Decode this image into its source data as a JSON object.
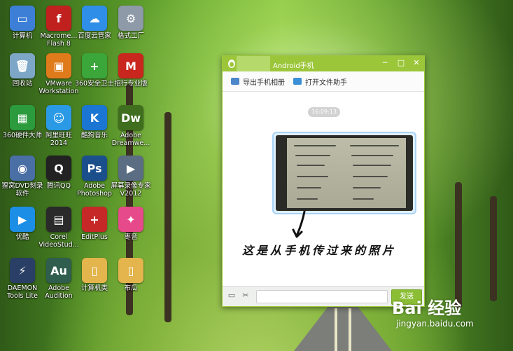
{
  "desktop": {
    "icons": [
      {
        "label": "计算机",
        "icon": "computer-icon",
        "color": "#3d7fd6",
        "glyph": "▭"
      },
      {
        "label": "Macrome... Flash 8",
        "icon": "flash-icon",
        "color": "#c0201e",
        "glyph": "f"
      },
      {
        "label": "百度云管家",
        "icon": "baidu-cloud-icon",
        "color": "#2f8ee8",
        "glyph": "☁"
      },
      {
        "label": "格式工厂",
        "icon": "format-factory-icon",
        "color": "#8e9aa8",
        "glyph": "⚙"
      },
      {
        "label": "回收站",
        "icon": "recycle-bin-icon",
        "color": "#7ea7c7",
        "glyph": "🗑"
      },
      {
        "label": "VMware Workstation",
        "icon": "vmware-icon",
        "color": "#e07b1c",
        "glyph": "▣"
      },
      {
        "label": "360安全卫士",
        "icon": "360-safe-icon",
        "color": "#3ba63a",
        "glyph": "+"
      },
      {
        "label": "招行专业版",
        "icon": "cmb-icon",
        "color": "#c9261d",
        "glyph": "M"
      },
      {
        "label": "360硬件大师",
        "icon": "360-hardware-icon",
        "color": "#2c9b3e",
        "glyph": "▦"
      },
      {
        "label": "阿里旺旺 2014",
        "icon": "aliwangwang-icon",
        "color": "#2b9ae6",
        "glyph": "☺"
      },
      {
        "label": "酷狗音乐",
        "icon": "kugou-icon",
        "color": "#1b76d3",
        "glyph": "K"
      },
      {
        "label": "Adobe Dreamwe...",
        "icon": "dreamweaver-icon",
        "color": "#3f6e1e",
        "glyph": "Dw"
      },
      {
        "label": "狸窝DVD刻录软件",
        "icon": "dvd-burner-icon",
        "color": "#4a6fa5",
        "glyph": "◉"
      },
      {
        "label": "腾讯QQ",
        "icon": "qq-icon",
        "color": "#222222",
        "glyph": "Q"
      },
      {
        "label": "Adobe Photoshop",
        "icon": "photoshop-icon",
        "color": "#1b4f8c",
        "glyph": "Ps"
      },
      {
        "label": "屏幕录像专家V2012",
        "icon": "screen-recorder-icon",
        "color": "#5b6d82",
        "glyph": "▶"
      },
      {
        "label": "优酷",
        "icon": "youku-icon",
        "color": "#1c8ee6",
        "glyph": "▶"
      },
      {
        "label": "Corel VideoStud...",
        "icon": "corel-video-icon",
        "color": "#2a2a2a",
        "glyph": "▤"
      },
      {
        "label": "EditPlus",
        "icon": "editplus-icon",
        "color": "#c62828",
        "glyph": "+"
      },
      {
        "label": "枣音",
        "icon": "zaoyin-icon",
        "color": "#e64a8a",
        "glyph": "✦"
      },
      {
        "label": "DAEMON Tools Lite",
        "icon": "daemon-tools-icon",
        "color": "#2a3f66",
        "glyph": "⚡"
      },
      {
        "label": "Adobe Audition",
        "icon": "audition-icon",
        "color": "#2f5e4f",
        "glyph": "Au"
      },
      {
        "label": "计算机类",
        "icon": "folder-icon",
        "color": "#e3b54c",
        "glyph": "▯"
      },
      {
        "label": "布瓜",
        "icon": "folder-icon",
        "color": "#e3b54c",
        "glyph": "▯"
      }
    ]
  },
  "window": {
    "title": "Android手机",
    "toolbar": [
      {
        "label": "导出手机相册",
        "icon": "export-album-icon"
      },
      {
        "label": "打开文件助手",
        "icon": "open-folder-icon"
      }
    ],
    "timestamp": "16:09:13",
    "send_label": "发送",
    "accent": "#9cc63a"
  },
  "annotation": "这是从手机传过来的照片",
  "watermark": {
    "brand": "Bai 经验",
    "url": "jingyan.baidu.com"
  }
}
